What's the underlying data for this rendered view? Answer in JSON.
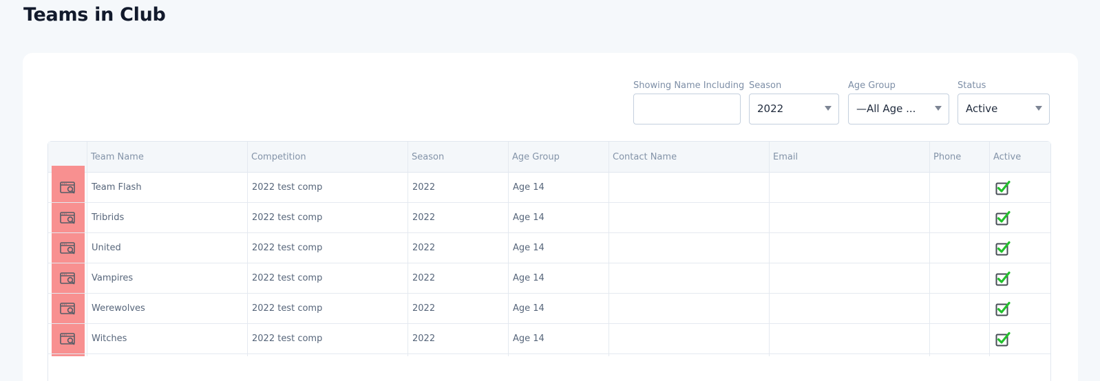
{
  "page": {
    "title": "Teams in Club"
  },
  "filters": {
    "name_label": "Showing Name Including",
    "name_value": "",
    "season_label": "Season",
    "season_value": "2022",
    "age_group_label": "Age Group",
    "age_group_value": "—All Age ...",
    "status_label": "Status",
    "status_value": "Active"
  },
  "table": {
    "columns": [
      "Team Name",
      "Competition",
      "Season",
      "Age Group",
      "Contact Name",
      "Email",
      "Phone",
      "Active"
    ],
    "rows": [
      {
        "team": "Team Flash",
        "competition": "2022 test comp",
        "season": "2022",
        "age_group": "Age 14",
        "contact": "",
        "email": "",
        "phone": "",
        "active": true
      },
      {
        "team": "Tribrids",
        "competition": "2022 test comp",
        "season": "2022",
        "age_group": "Age 14",
        "contact": "",
        "email": "",
        "phone": "",
        "active": true
      },
      {
        "team": "United",
        "competition": "2022 test comp",
        "season": "2022",
        "age_group": "Age 14",
        "contact": "",
        "email": "",
        "phone": "",
        "active": true
      },
      {
        "team": "Vampires",
        "competition": "2022 test comp",
        "season": "2022",
        "age_group": "Age 14",
        "contact": "",
        "email": "",
        "phone": "",
        "active": true
      },
      {
        "team": "Werewolves",
        "competition": "2022 test comp",
        "season": "2022",
        "age_group": "Age 14",
        "contact": "",
        "email": "",
        "phone": "",
        "active": true
      },
      {
        "team": "Witches",
        "competition": "2022 test comp",
        "season": "2022",
        "age_group": "Age 14",
        "contact": "",
        "email": "",
        "phone": "",
        "active": true
      }
    ]
  },
  "icons": {
    "view": "view-details-icon",
    "active": "checkbox-checked-icon"
  },
  "colors": {
    "highlight": "#f89090",
    "check_green": "#22c02c",
    "title": "#121a2c"
  }
}
